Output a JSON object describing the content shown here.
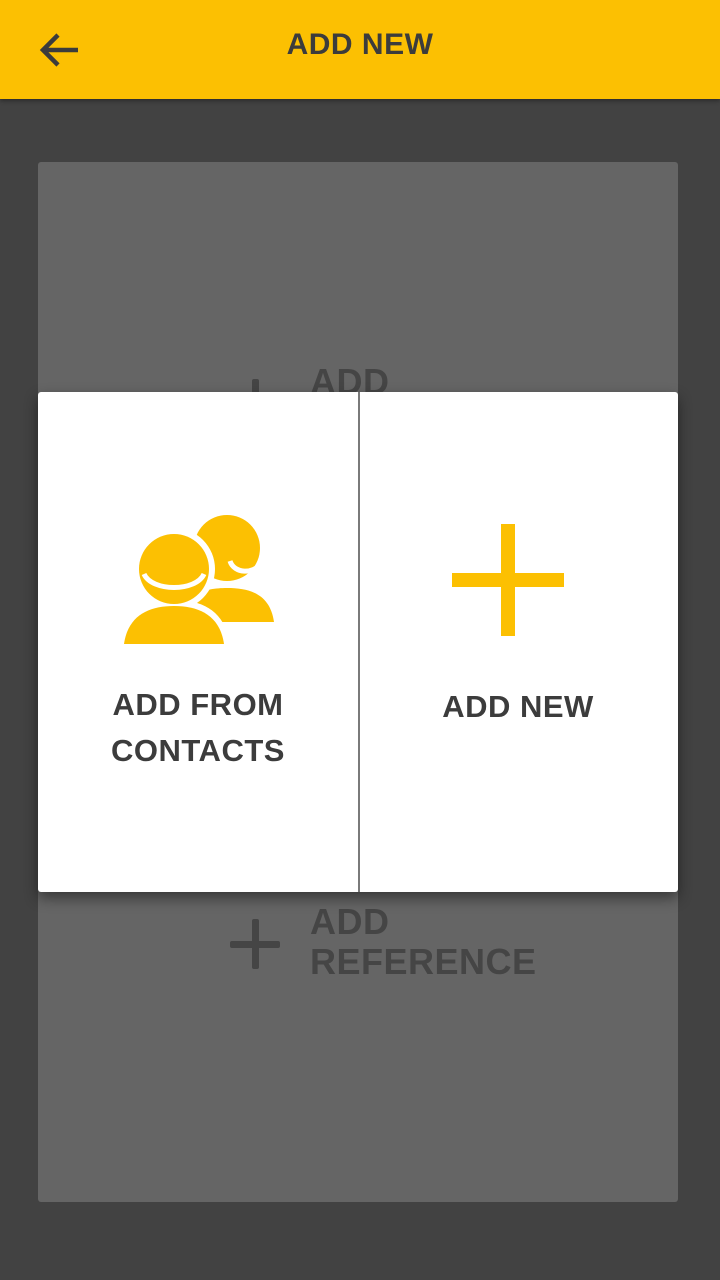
{
  "app_bar": {
    "title": "ADD NEW",
    "back_icon": "arrow-left-icon",
    "color": "#FCC002"
  },
  "background": {
    "items": [
      {
        "label": "ADD",
        "icon": "plus-icon"
      },
      {
        "label": "ADD\nREFERENCE",
        "icon": "plus-icon"
      }
    ]
  },
  "dialog": {
    "options": [
      {
        "label": "ADD FROM\nCONTACTS",
        "icon": "contacts-icon"
      },
      {
        "label": "ADD NEW",
        "icon": "plus-icon"
      }
    ],
    "accent": "#FCC002"
  }
}
